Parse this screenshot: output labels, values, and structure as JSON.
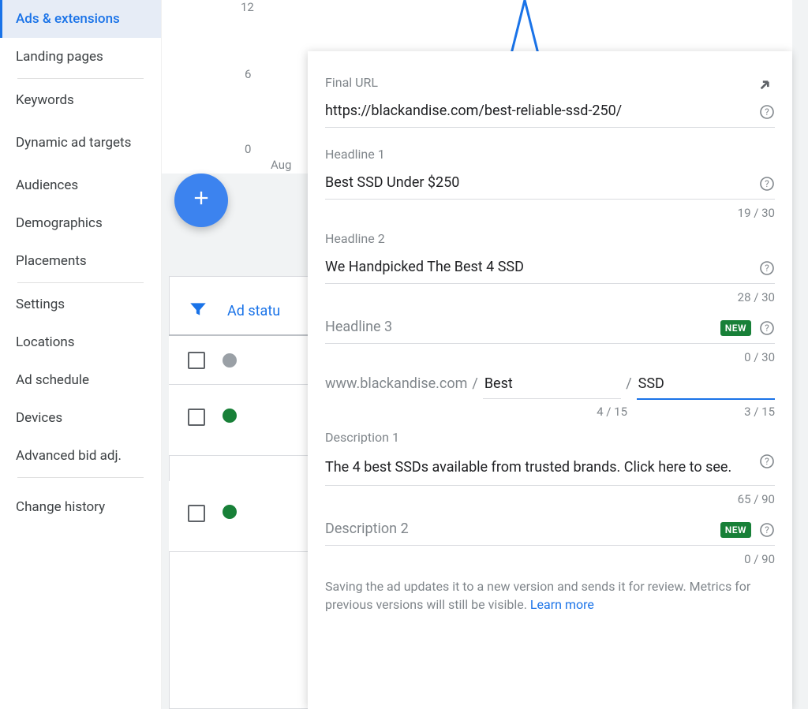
{
  "sidebar": {
    "items": [
      {
        "label": "Ads & extensions",
        "selected": true
      },
      {
        "label": "Landing pages"
      },
      {
        "label": "Keywords"
      },
      {
        "label": "Dynamic ad targets",
        "tall": true
      },
      {
        "label": "Audiences"
      },
      {
        "label": "Demographics"
      },
      {
        "label": "Placements"
      },
      {
        "label": "Settings"
      },
      {
        "label": "Locations"
      },
      {
        "label": "Ad schedule"
      },
      {
        "label": "Devices"
      },
      {
        "label": "Advanced bid adj."
      },
      {
        "label": "Change history"
      }
    ]
  },
  "chart": {
    "y12": "12",
    "y6": "6",
    "y0": "0",
    "xAug": "Aug"
  },
  "table": {
    "filter_label": "Ad statu",
    "rows": [
      {
        "status": "grey"
      },
      {
        "status": "green"
      },
      {
        "status": "green"
      }
    ]
  },
  "panel": {
    "final_url_label": "Final URL",
    "final_url": "https://blackandise.com/best-reliable-ssd-250/",
    "h1_label": "Headline 1",
    "h1": "Best SSD Under $250",
    "h1_count": "19 / 30",
    "h2_label": "Headline 2",
    "h2": "We Handpicked The Best 4 SSD",
    "h2_count": "28 / 30",
    "h3_label": "Headline 3",
    "h3_count": "0 / 30",
    "new_badge": "NEW",
    "path_domain": "www.blackandise.com",
    "slash": "/",
    "path1": "Best",
    "path2": "SSD",
    "path1_count": "4 / 15",
    "path2_count": "3 / 15",
    "d1_label": "Description 1",
    "d1": "The 4 best SSDs available from trusted brands. Click here to see.",
    "d1_count": "65 / 90",
    "d2_label": "Description 2",
    "d2_count": "0 / 90",
    "save_note": "Saving the ad updates it to a new version and sends it for review. Metrics for previous versions will still be visible. ",
    "learn_more": "Learn more"
  }
}
